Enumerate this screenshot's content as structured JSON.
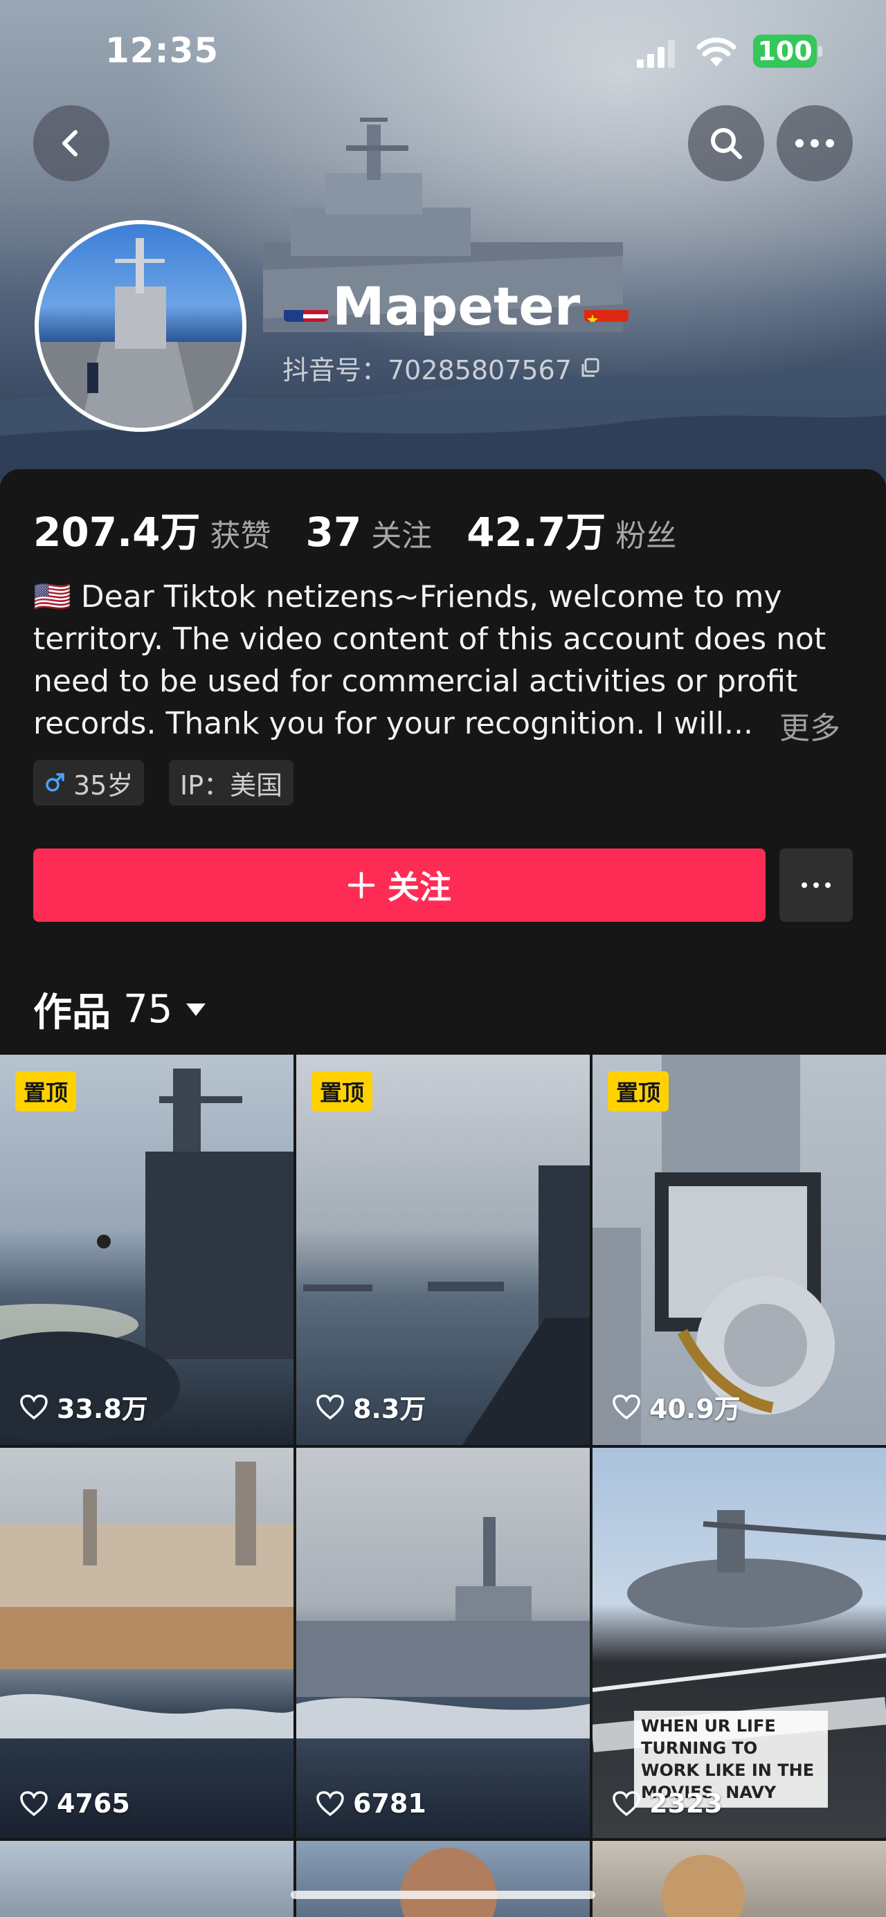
{
  "status": {
    "time": "12:35",
    "battery": "100"
  },
  "profile": {
    "name": "Mapeter",
    "douyin_id": "抖音号：70285807567",
    "stats": [
      {
        "value": "207.4万",
        "label": "获赞"
      },
      {
        "value": "37",
        "label": "关注"
      },
      {
        "value": "42.7万",
        "label": "粉丝"
      }
    ],
    "bio": "🇺🇸 Dear Tiktok netizens~Friends, welcome to my territory. The video content of this account does not need to be used for commercial activities or profit records. Thank you for your recognition. I will...",
    "more": "更多",
    "tags": {
      "age": "35岁",
      "ip": "IP：美国"
    },
    "follow_label": "关注",
    "works_label": "作品",
    "works_count": "75"
  },
  "videos": [
    {
      "pinned": "置顶",
      "likes": "33.8万",
      "scene": "carrier-helicopter"
    },
    {
      "pinned": "置顶",
      "likes": "8.3万",
      "scene": "ocean-ships"
    },
    {
      "pinned": "置顶",
      "likes": "40.9万",
      "scene": "ciws-gun"
    },
    {
      "pinned": "",
      "likes": "4765",
      "scene": "supply-ship"
    },
    {
      "pinned": "",
      "likes": "6781",
      "scene": "destroyer"
    },
    {
      "pinned": "",
      "likes": "2323",
      "scene": "helicopter-deck",
      "caption": "WHEN UR LIFE TURNING TO WORK LIKE IN THE MOVIES, NAVY"
    }
  ],
  "colors": {
    "accent": "#fe2c55",
    "pin": "#ffd200",
    "background": "#161616"
  }
}
